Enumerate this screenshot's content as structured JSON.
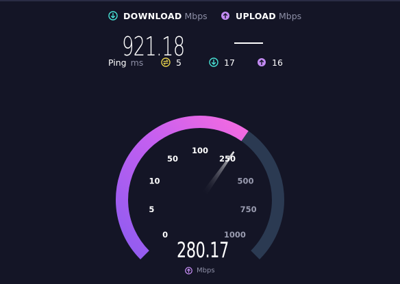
{
  "download": {
    "label": "DOWNLOAD",
    "unit": "Mbps",
    "value": "921.18"
  },
  "upload": {
    "label": "UPLOAD",
    "unit": "Mbps",
    "value": "—"
  },
  "ping": {
    "label": "Ping",
    "unit": "ms",
    "idle": "5",
    "download": "17",
    "upload": "16"
  },
  "gauge": {
    "ticks": [
      "0",
      "5",
      "10",
      "50",
      "100",
      "250",
      "500",
      "750",
      "1000"
    ],
    "reading": "280.17",
    "unit": "Mbps",
    "fill_fraction": 0.63
  },
  "icons": {
    "download": "download-arrow-icon",
    "upload": "upload-arrow-icon",
    "idle_ping": "swap-arrows-icon"
  },
  "colors": {
    "download": "#47e1d4",
    "upload": "#c38bf2",
    "idle": "#e8d24a",
    "gauge_start": "#8e5cf0",
    "gauge_end": "#f56be0",
    "gauge_track": "#2b3a52",
    "background": "#141526"
  }
}
